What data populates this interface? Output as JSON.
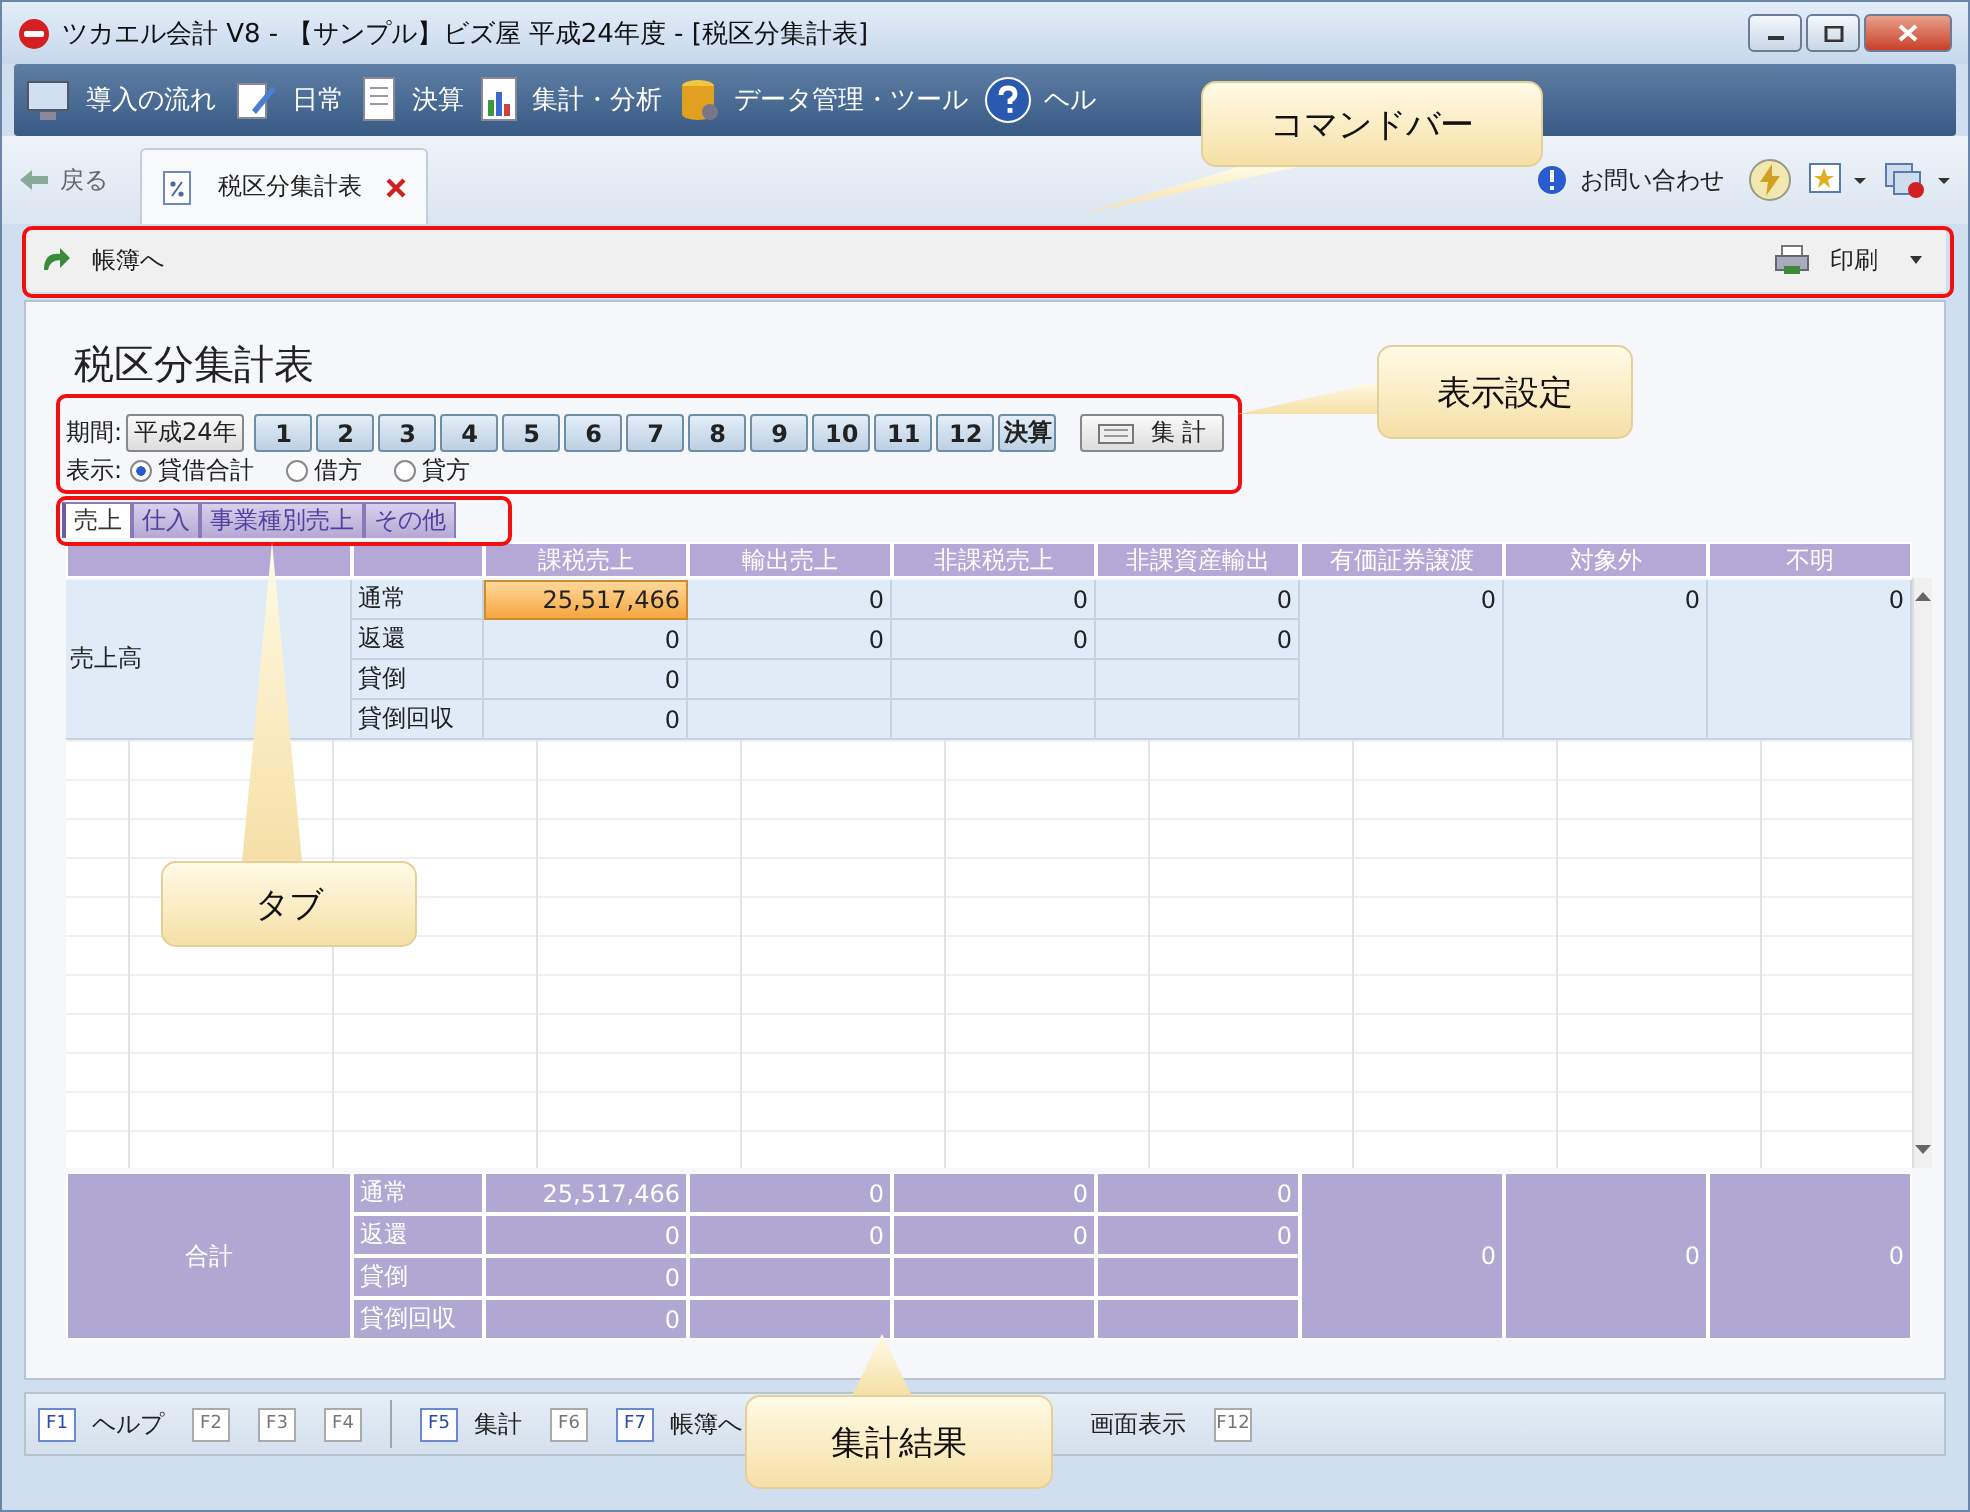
{
  "window": {
    "title": "ツカエル会計 V8 - 【サンプル】ビズ屋 平成24年度 - [税区分集計表]"
  },
  "menu": [
    {
      "label": "導入の流れ"
    },
    {
      "label": "日常"
    },
    {
      "label": "決算"
    },
    {
      "label": "集計・分析"
    },
    {
      "label": "データ管理・ツール"
    },
    {
      "label": "ヘル"
    }
  ],
  "nav": {
    "back": "戻る",
    "tab": "税区分集計表",
    "contact": "お問い合わせ"
  },
  "command_bar": {
    "ledger": "帳簿へ",
    "print": "印刷"
  },
  "page_title": "税区分集計表",
  "period": {
    "label": "期間:",
    "year": "平成24年",
    "months": [
      "1",
      "2",
      "3",
      "4",
      "5",
      "6",
      "7",
      "8",
      "9",
      "10",
      "11",
      "12",
      "決算"
    ],
    "aggregate": "集 計"
  },
  "display": {
    "label": "表示:",
    "options": [
      {
        "label": "貸借合計",
        "selected": true
      },
      {
        "label": "借方",
        "selected": false
      },
      {
        "label": "貸方",
        "selected": false
      }
    ]
  },
  "tabs": [
    {
      "label": "売上",
      "selected": true
    },
    {
      "label": "仕入",
      "selected": false
    },
    {
      "label": "事業種別売上",
      "selected": false
    },
    {
      "label": "その他",
      "selected": false
    }
  ],
  "table": {
    "columns": [
      "課税売上",
      "輸出売上",
      "非課税売上",
      "非課資産輸出",
      "有価証券譲渡",
      "対象外",
      "不明"
    ],
    "sales": {
      "label": "売上高",
      "rows": [
        {
          "label": "通常",
          "cells": [
            {
              "value": "25,517,466",
              "selected": true
            },
            {
              "value": "0",
              "selected": false
            },
            {
              "value": "0",
              "selected": false
            },
            {
              "value": "0",
              "selected": false
            }
          ]
        },
        {
          "label": "返還",
          "cells": [
            {
              "value": "0",
              "selected": false
            },
            {
              "value": "0",
              "selected": false
            },
            {
              "value": "0",
              "selected": false
            },
            {
              "value": "0",
              "selected": false
            }
          ]
        },
        {
          "label": "貸倒",
          "cells": [
            {
              "value": "0",
              "selected": false
            }
          ]
        },
        {
          "label": "貸倒回収",
          "cells": [
            {
              "value": "0",
              "selected": false
            }
          ]
        }
      ],
      "merged": [
        "0",
        "0",
        "0"
      ]
    },
    "total": {
      "label": "合計",
      "rows": [
        {
          "label": "通常",
          "cells": [
            "25,517,466",
            "0",
            "0",
            "0"
          ]
        },
        {
          "label": "返還",
          "cells": [
            "0",
            "0",
            "0",
            "0"
          ]
        },
        {
          "label": "貸倒",
          "cells": [
            "0"
          ]
        },
        {
          "label": "貸倒回収",
          "cells": [
            "0"
          ]
        }
      ],
      "merged": [
        "0",
        "0",
        "0"
      ]
    }
  },
  "function_keys": [
    {
      "key": "F1",
      "label": "ヘルプ",
      "enabled": true
    },
    {
      "key": "F2",
      "enabled": false
    },
    {
      "key": "F3",
      "enabled": false
    },
    {
      "key": "F4",
      "enabled": false
    },
    {
      "key": "F5",
      "label": "集計",
      "enabled": true
    },
    {
      "key": "F6",
      "enabled": false
    },
    {
      "key": "F7",
      "label": "帳簿へ",
      "enabled": true
    },
    {
      "label": "画面表示",
      "enabled": true
    },
    {
      "key": "F12",
      "enabled": false
    }
  ],
  "callouts": [
    "コマンドバー",
    "表示設定",
    "タブ",
    "集計結果"
  ]
}
